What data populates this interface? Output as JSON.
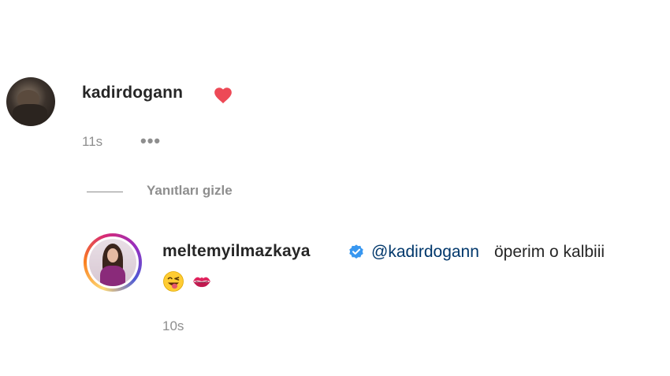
{
  "comment": {
    "username": "kadirdogann",
    "reaction_icon": "red-heart",
    "time": "11s",
    "more_label": "•••"
  },
  "replies_toggle": {
    "label": "Yanıtları gizle"
  },
  "reply": {
    "username": "meltemyilmazkaya",
    "verified_icon": "verified-badge",
    "mention": "@kadirdogann",
    "text": "öperim o kalbiii",
    "emojis": [
      "face-with-tongue-wink",
      "kiss-mark"
    ],
    "time": "10s"
  },
  "colors": {
    "text": "#262626",
    "secondary": "#8e8e8e",
    "mention": "#00376b",
    "heart": "#ed4956",
    "verified": "#3897f0"
  }
}
